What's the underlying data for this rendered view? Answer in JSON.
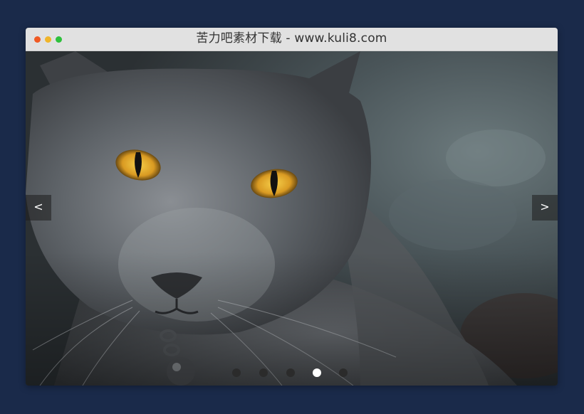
{
  "window": {
    "title": "苦力吧素材下载 - www.kuli8.com",
    "traffic_lights": {
      "close_color": "#f05a24",
      "minimize_color": "#f0b52a",
      "maximize_color": "#2ec13c"
    }
  },
  "slider": {
    "prev_label": "<",
    "next_label": ">",
    "slide_count": 5,
    "active_index": 3,
    "dot_color": "#2b2b2b",
    "active_dot_color": "#ffffff",
    "image_subject": "gray cat with amber eyes"
  }
}
